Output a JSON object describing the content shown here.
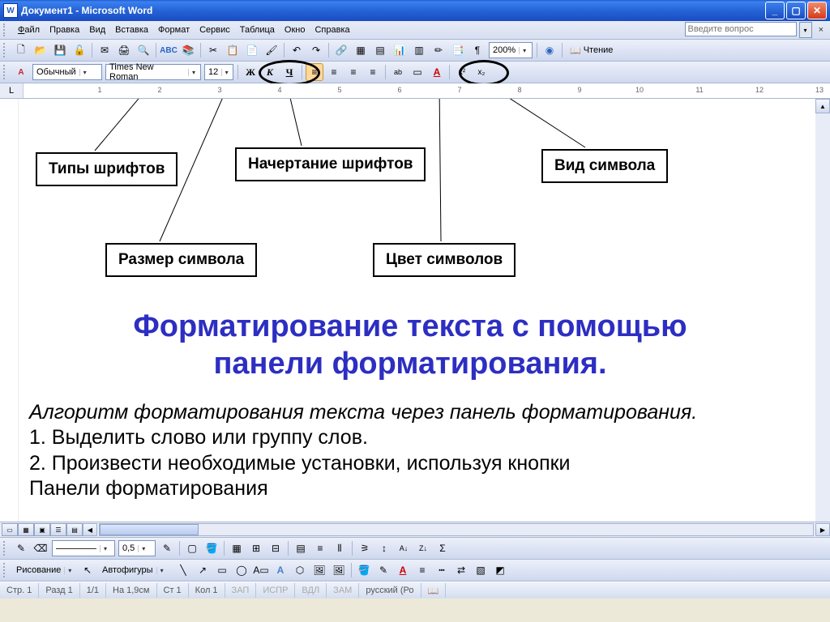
{
  "title": "Документ1 - Microsoft Word",
  "menu": {
    "file": "Файл",
    "edit": "Правка",
    "view": "Вид",
    "insert": "Вставка",
    "format": "Формат",
    "tools": "Сервис",
    "table": "Таблица",
    "window": "Окно",
    "help": "Справка"
  },
  "askbox_placeholder": "Введите вопрос",
  "toolbar1": {
    "zoom": "200%",
    "reading": "Чтение"
  },
  "toolbar2": {
    "style": "Обычный",
    "font": "Times New Roman",
    "size": "12",
    "bold": "Ж",
    "italic": "К",
    "underline": "Ч",
    "sup": "x²",
    "sub": "x₂"
  },
  "toolbar3": {
    "linewidth": "0,5"
  },
  "callouts": {
    "c1": "Типы шрифтов",
    "c2": "Начертание шрифтов",
    "c3": "Вид символа",
    "c4": "Размер символа",
    "c5": "Цвет символов"
  },
  "doc": {
    "title1": "Форматирование текста с помощью",
    "title2": "панели форматирования.",
    "italic_line": "Алгоритм форматирования текста через панель форматирования.",
    "l1": "1. Выделить слово или группу слов.",
    "l2": "2. Произвести необходимые установки, используя кнопки",
    "l3": "Панели форматирования"
  },
  "drawbar": {
    "drawing": "Рисование",
    "autoshapes": "Автофигуры"
  },
  "status": {
    "page": "Стр. 1",
    "section": "Разд 1",
    "pages": "1/1",
    "at": "На 1,9см",
    "line": "Ст 1",
    "col": "Кол 1",
    "rec": "ЗАП",
    "trk": "ИСПР",
    "ext": "ВДЛ",
    "ovr": "ЗАМ",
    "lang": "русский (Ро"
  }
}
